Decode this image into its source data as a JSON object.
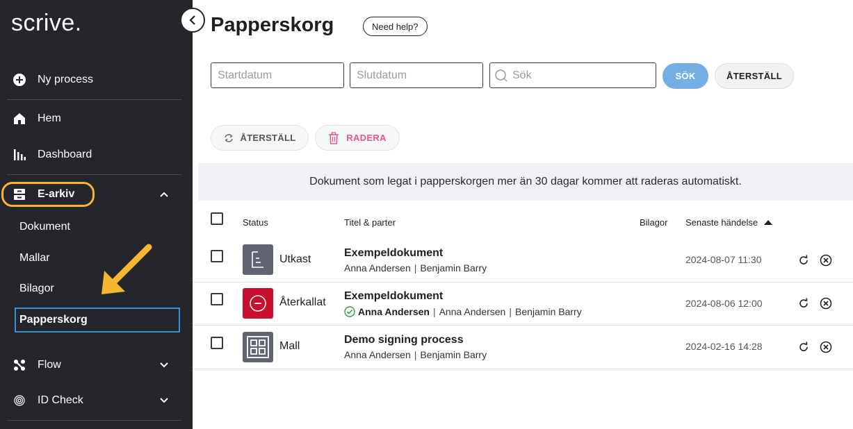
{
  "sidebar": {
    "logo": "scrive.",
    "new_process": "Ny process",
    "home": "Hem",
    "dashboard": "Dashboard",
    "earkiv": "E-arkiv",
    "sub_items": [
      "Dokument",
      "Mallar",
      "Bilagor",
      "Papperskorg"
    ],
    "flow": "Flow",
    "id_check": "ID Check"
  },
  "header": {
    "title": "Papperskorg",
    "help": "Need help?"
  },
  "filters": {
    "start_placeholder": "Startdatum",
    "end_placeholder": "Slutdatum",
    "search_placeholder": "Sök",
    "search_button": "SÖK",
    "reset_button": "ÅTERSTÄLL"
  },
  "actions": {
    "restore": "ÅTERSTÄLL",
    "delete": "RADERA"
  },
  "notice": "Dokument som legat i papperskorgen mer än 30 dagar kommer att raderas automatiskt.",
  "table": {
    "columns": {
      "status": "Status",
      "title": "Titel & parter",
      "attachments": "Bilagor",
      "last_event": "Senaste händelse"
    },
    "rows": [
      {
        "status": "Utkast",
        "title": "Exempeldokument",
        "signed": "",
        "parties": [
          "Anna Andersen",
          "Benjamin Barry"
        ],
        "date": "2024-08-07 11:30"
      },
      {
        "status": "Återkallat",
        "title": "Exempeldokument",
        "signed": "Anna Andersen",
        "parties": [
          "Anna Andersen",
          "Benjamin Barry"
        ],
        "date": "2024-08-06 12:00"
      },
      {
        "status": "Mall",
        "title": "Demo signing process",
        "signed": "",
        "parties": [
          "Anna Andersen",
          "Benjamin Barry"
        ],
        "date": "2024-02-16 14:28"
      }
    ]
  },
  "colors": {
    "sidebar_bg": "#25262b",
    "highlight": "#f5b731",
    "active_border": "#3d8fd6",
    "search_button": "#74aee3",
    "delete_text": "#e0588a",
    "draft_icon": "#5f6470",
    "revoked_icon": "#c8102e",
    "signed_check": "#2a9d4a"
  }
}
